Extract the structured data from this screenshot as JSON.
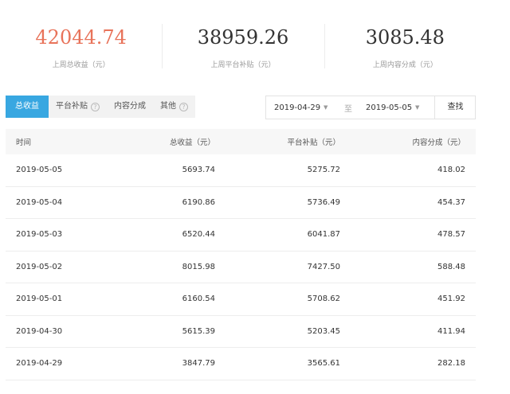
{
  "stats": [
    {
      "value": "42044.74",
      "label": "上周总收益（元）"
    },
    {
      "value": "38959.26",
      "label": "上周平台补贴（元）"
    },
    {
      "value": "3085.48",
      "label": "上周内容分成（元）"
    }
  ],
  "tabs": [
    {
      "label": "总收益",
      "active": true
    },
    {
      "label": "平台补贴",
      "help": "?"
    },
    {
      "label": "内容分成"
    },
    {
      "label": "其他",
      "help": "?"
    }
  ],
  "date_range": {
    "start": "2019-04-29",
    "separator": "至",
    "end": "2019-05-05",
    "search_label": "查找"
  },
  "table": {
    "headers": [
      "时间",
      "总收益（元）",
      "平台补贴（元）",
      "内容分成（元）"
    ],
    "rows": [
      [
        "2019-05-05",
        "5693.74",
        "5275.72",
        "418.02"
      ],
      [
        "2019-05-04",
        "6190.86",
        "5736.49",
        "454.37"
      ],
      [
        "2019-05-03",
        "6520.44",
        "6041.87",
        "478.57"
      ],
      [
        "2019-05-02",
        "8015.98",
        "7427.50",
        "588.48"
      ],
      [
        "2019-05-01",
        "6160.54",
        "5708.62",
        "451.92"
      ],
      [
        "2019-04-30",
        "5615.39",
        "5203.45",
        "411.94"
      ],
      [
        "2019-04-29",
        "3847.79",
        "3565.61",
        "282.18"
      ]
    ]
  },
  "colors": {
    "accent_value": "#e8735a",
    "active_tab": "#38a7e1"
  },
  "icons": {
    "caret": "caret-down-icon",
    "help": "help-circle-icon"
  }
}
